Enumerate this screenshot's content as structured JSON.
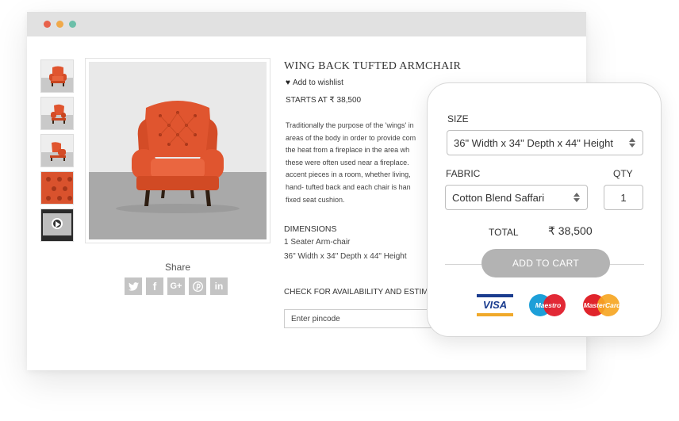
{
  "window": {
    "controls": [
      "close",
      "minimize",
      "maximize"
    ]
  },
  "product": {
    "title": "WING BACK TUFTED ARMCHAIR",
    "wishlist_label": "Add to wishlist",
    "starts_at": "STARTS AT ₹ 38,500",
    "description": "Traditionally the purpose of the 'wings' in\nareas of the body in order to provide com\nthe heat from a fireplace in the area wh\nthese were often used near a fireplace.\naccent pieces in a room, whether living,\nhand- tufted back and each chair is han\nfixed seat cushion.",
    "dimensions_title": "DIMENSIONS",
    "dimensions_line1": "1 Seater Arm-chair",
    "dimensions_line2": "36\" Width x 34\" Depth x 44\" Height",
    "check_label": "CHECK FOR AVAILABILITY AND ESTIMA",
    "pincode_placeholder": "Enter pincode"
  },
  "gallery": {
    "thumbnails": [
      "chair-front",
      "chair-side",
      "chair-angle",
      "fabric-closeup",
      "video"
    ],
    "share_label": "Share",
    "share_buttons": [
      {
        "icon": "twitter-icon",
        "glyph": "🐦"
      },
      {
        "icon": "facebook-icon",
        "glyph": "f"
      },
      {
        "icon": "google-plus-icon",
        "glyph": "G+"
      },
      {
        "icon": "pinterest-icon",
        "glyph": "℗"
      },
      {
        "icon": "linkedin-icon",
        "glyph": "in"
      }
    ]
  },
  "cart": {
    "size_label": "SIZE",
    "size_value": "36\" Width x 34\" Depth x 44\" Height",
    "fabric_label": "FABRIC",
    "fabric_value": "Cotton Blend Saffari",
    "qty_label": "QTY",
    "qty_value": "1",
    "total_label": "TOTAL",
    "total_value": "₹ 38,500",
    "add_button": "ADD TO CART",
    "payments": {
      "visa": "VISA",
      "maestro": "Maestro",
      "mastercard": "MasterCard"
    }
  },
  "colors": {
    "chair": "#e0552f",
    "button": "#b3b3b3",
    "share": "#c4c4c4"
  }
}
